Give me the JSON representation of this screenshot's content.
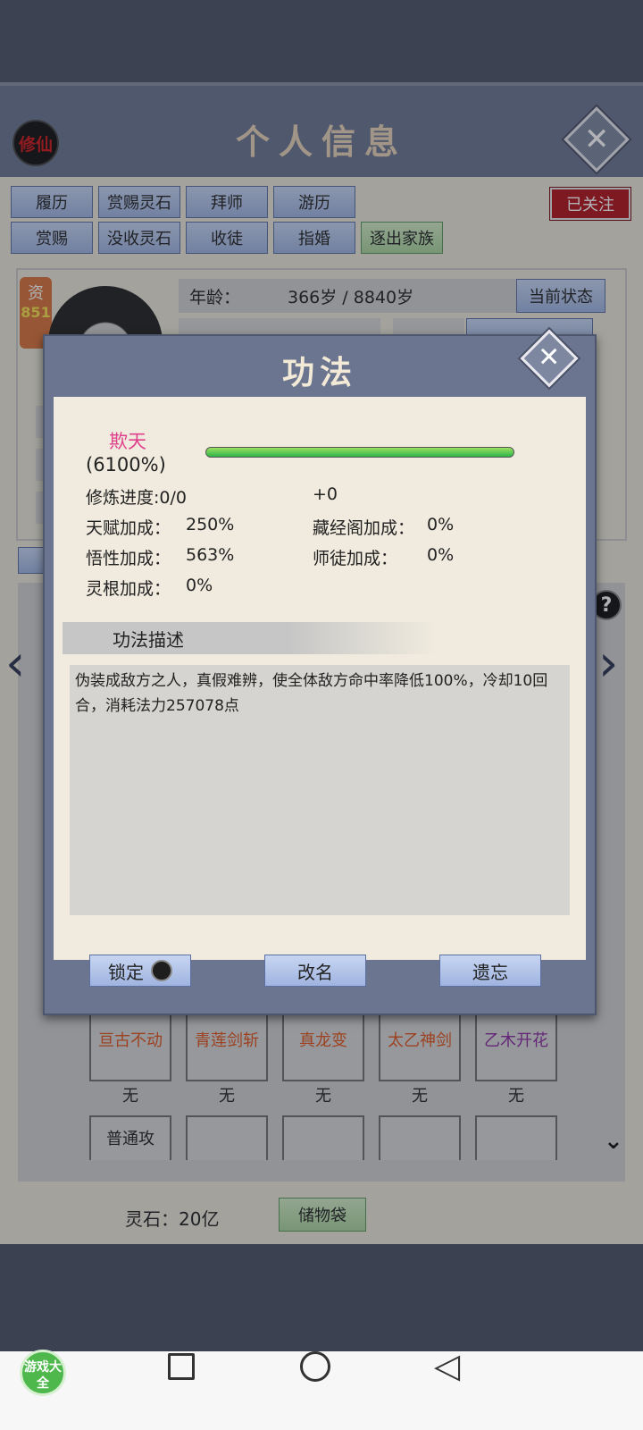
{
  "header": {
    "title": "个人信息",
    "logo_text": "修仙"
  },
  "tabs_row1": [
    "履历",
    "赏赐灵石",
    "拜师",
    "游历"
  ],
  "tabs_row2": [
    "赏赐",
    "没收灵石",
    "收徒",
    "指婚",
    "逐出家族"
  ],
  "followed_label": "已关注",
  "profile": {
    "age_label": "年龄：",
    "age_value": "366岁 / 8840岁",
    "state_button": "当前状态",
    "zi_label": "资",
    "zi_value": "851"
  },
  "modal": {
    "title": "功法",
    "skill_name": "欺天",
    "skill_percent": "(6100%)",
    "progress_fraction": 1.0,
    "stats": {
      "progress_label": "修炼进度:",
      "progress_value": "0/0",
      "plus": "+0",
      "talent_label": "天赋加成：",
      "talent_value": "250%",
      "library_label": "藏经阁加成：",
      "library_value": "0%",
      "wisdom_label": "悟性加成：",
      "wisdom_value": "563%",
      "master_label": "师徒加成：",
      "master_value": "0%",
      "root_label": "灵根加成：",
      "root_value": "0%"
    },
    "desc_header": "功法描述",
    "description": "伪装成敌方之人，真假难辨，使全体敌方命中率降低100%，冷却10回合，消耗法力257078点",
    "buttons": {
      "lock": "锁定",
      "rename": "改名",
      "forget": "遗忘"
    }
  },
  "skills": [
    {
      "name": "亘古不动",
      "sub": "无"
    },
    {
      "name": "青莲剑斩",
      "sub": "无"
    },
    {
      "name": "真龙变",
      "sub": "无"
    },
    {
      "name": "太乙神剑",
      "sub": "无"
    },
    {
      "name": "乙木开花",
      "sub": "无"
    }
  ],
  "skills_row2_first": "普通攻",
  "footer": {
    "stone_label": "灵石：20亿",
    "bag_button": "储物袋"
  },
  "nav": {
    "game_badge": "游戏大全"
  },
  "colors": {
    "accent_red": "#b3151c",
    "skill_pink": "#e0418c",
    "skill_orange": "#e0541a",
    "skill_purple": "#8a2a9e"
  }
}
